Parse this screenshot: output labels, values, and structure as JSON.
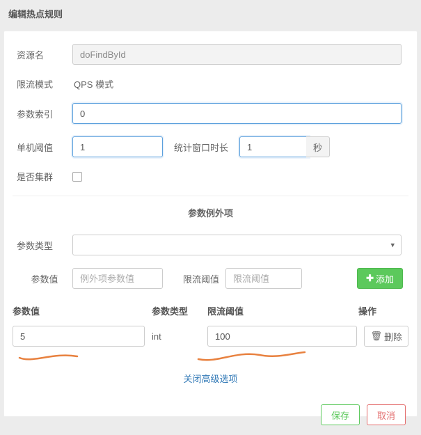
{
  "header": {
    "title": "编辑热点规则"
  },
  "fields": {
    "resourceLabel": "资源名",
    "resourceValue": "doFindById",
    "modeLabel": "限流模式",
    "modeValue": "QPS 模式",
    "indexLabel": "参数索引",
    "indexValue": "0",
    "thresholdLabel": "单机阈值",
    "thresholdValue": "1",
    "windowLabel": "统计窗口时长",
    "windowValue": "1",
    "windowUnit": "秒",
    "clusterLabel": "是否集群"
  },
  "exceptionSection": {
    "title": "参数例外项",
    "paramTypeLabel": "参数类型",
    "paramValLabel": "参数值",
    "paramValPlaceholder": "例外项参数值",
    "flowThresholdLabel": "限流阈值",
    "flowThresholdPlaceholder": "限流阈值",
    "addBtn": "添加"
  },
  "tableHead": {
    "col1": "参数值",
    "col2": "参数类型",
    "col3": "限流阈值",
    "col4": "操作"
  },
  "tableRows": [
    {
      "value": "5",
      "type": "int",
      "threshold": "100"
    }
  ],
  "deleteLabel": "删除",
  "closeAdvLabel": "关闭高级选项",
  "footer": {
    "save": "保存",
    "cancel": "取消"
  }
}
